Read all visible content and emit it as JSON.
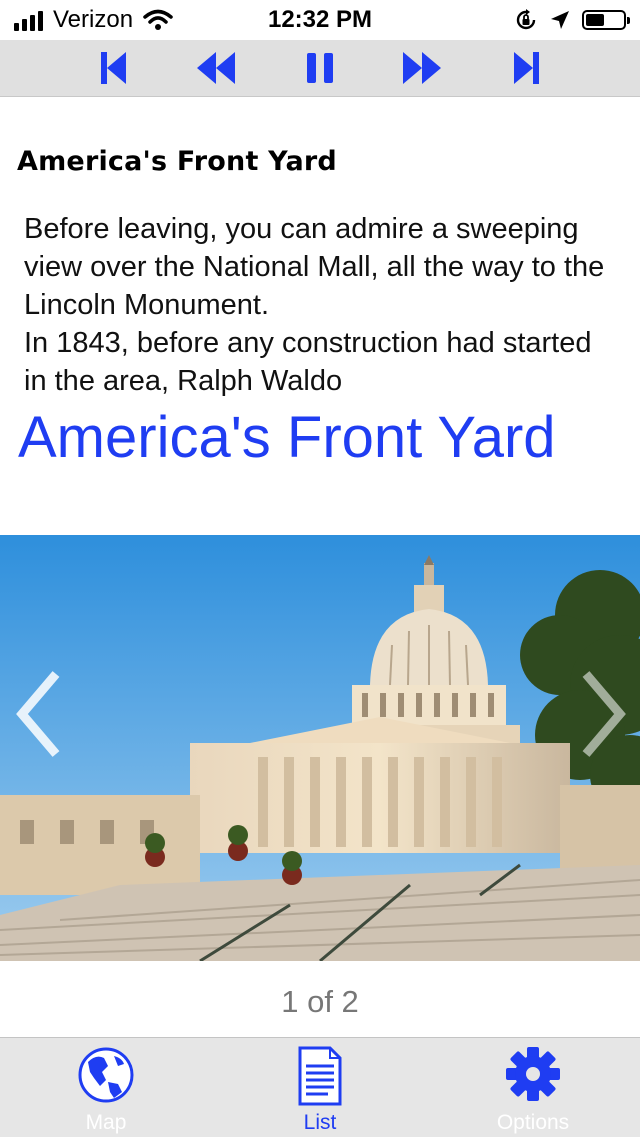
{
  "status_bar": {
    "carrier": "Verizon",
    "time": "12:32 PM",
    "battery_level": 0.55
  },
  "transport": {
    "buttons": [
      "skip-back-icon",
      "rewind-icon",
      "pause-icon",
      "fast-forward-icon",
      "skip-forward-icon"
    ],
    "accent": "#1f3df2"
  },
  "content": {
    "heading": "America's Front Yard",
    "body": "Before leaving, you can admire a sweeping view over the National Mall, all the way to the Lincoln Monument.\nIn 1843, before any construction had started in the area, Ralph Waldo",
    "big_title": "America's Front Yard",
    "big_title_color": "#1f3df2"
  },
  "gallery": {
    "image_subject": "capitol-building-photo",
    "page_indicator": "1 of 2"
  },
  "tab_bar": {
    "tabs": [
      {
        "label": "Map",
        "icon": "globe-icon",
        "selected": false
      },
      {
        "label": "List",
        "icon": "list-document-icon",
        "selected": true
      },
      {
        "label": "Options",
        "icon": "gear-icon",
        "selected": false
      }
    ],
    "selected_color": "#1f3df2",
    "unselected_label_color": "#ffffff"
  }
}
